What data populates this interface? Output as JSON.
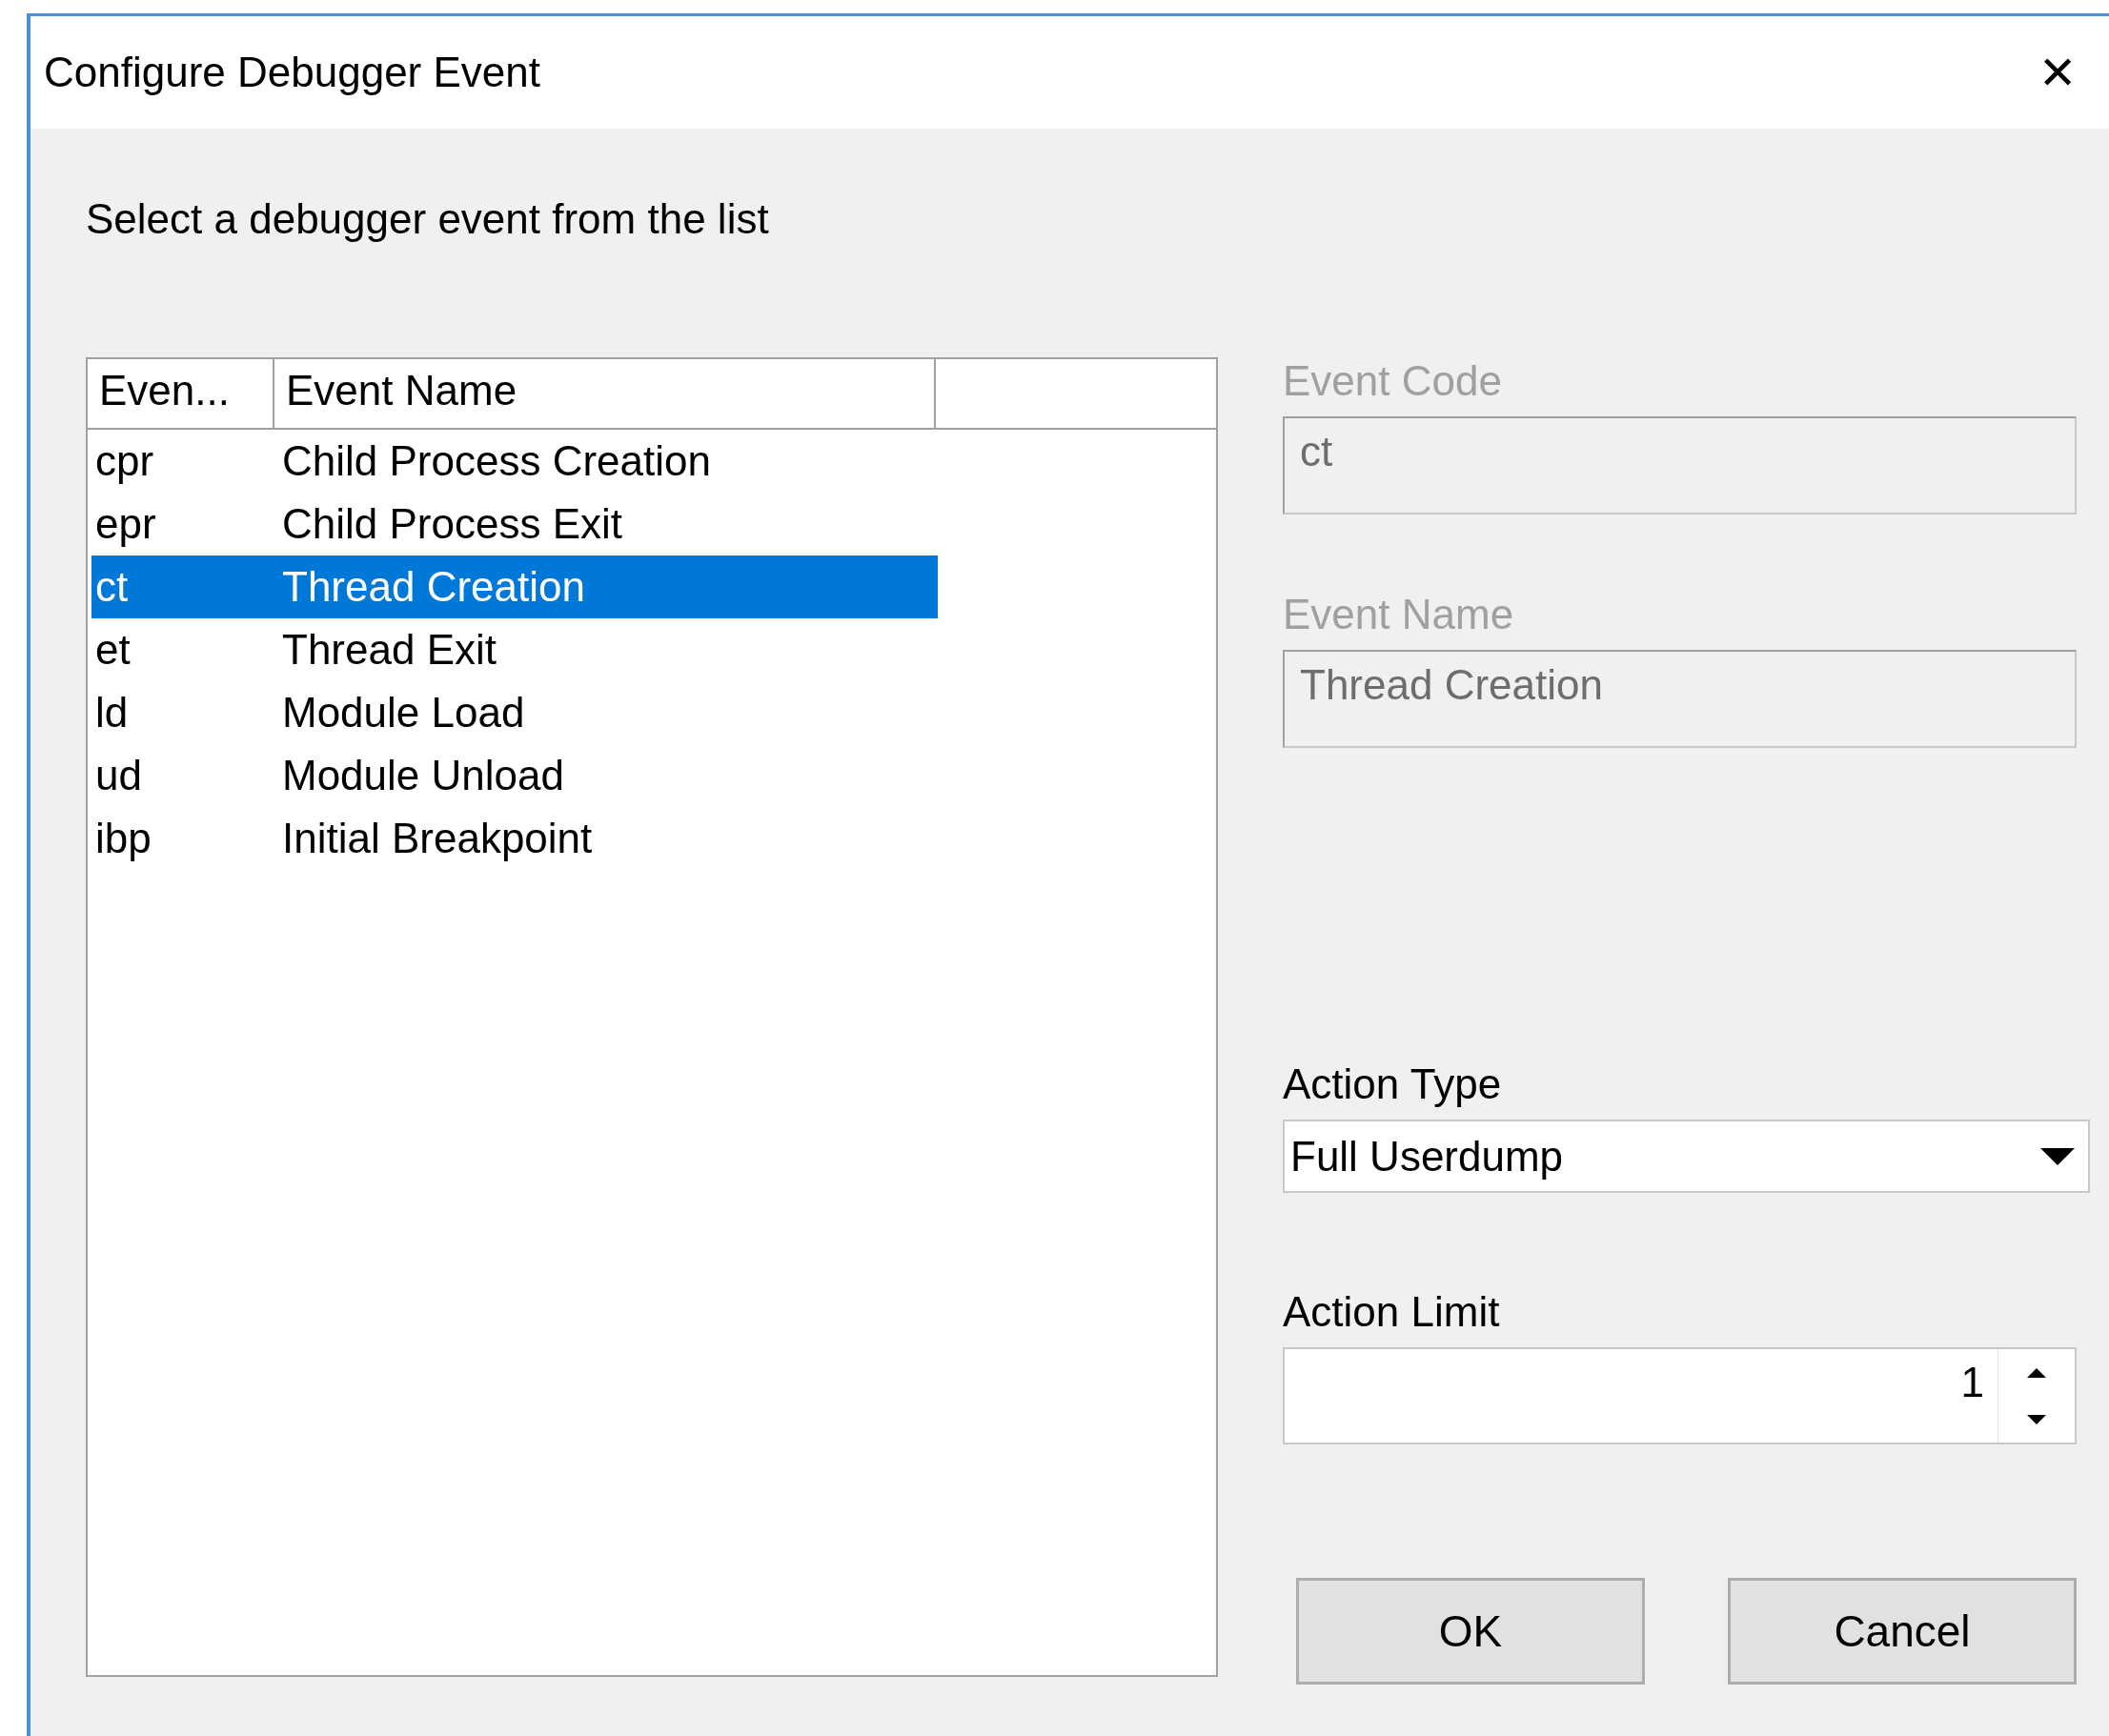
{
  "window": {
    "title": "Configure Debugger Event",
    "close": "✕"
  },
  "instruction": "Select a debugger event from the list",
  "list": {
    "columns": [
      "Even...",
      "Event Name"
    ],
    "rows": [
      {
        "code": "cpr",
        "name": "Child Process Creation",
        "selected": false
      },
      {
        "code": "epr",
        "name": "Child Process Exit",
        "selected": false
      },
      {
        "code": "ct",
        "name": "Thread Creation",
        "selected": true
      },
      {
        "code": "et",
        "name": "Thread Exit",
        "selected": false
      },
      {
        "code": "ld",
        "name": "Module Load",
        "selected": false
      },
      {
        "code": "ud",
        "name": "Module Unload",
        "selected": false
      },
      {
        "code": "ibp",
        "name": "Initial Breakpoint",
        "selected": false
      }
    ]
  },
  "fields": [
    {
      "kind": "text",
      "label": "Event Code",
      "value": "ct",
      "disabled": true
    },
    {
      "kind": "text",
      "label": "Event Name",
      "value": "Thread Creation",
      "disabled": true
    },
    {
      "kind": "combo",
      "label": "Action Type",
      "value": "Full Userdump",
      "disabled": false
    },
    {
      "kind": "spin",
      "label": "Action Limit",
      "value": "1",
      "disabled": false
    }
  ],
  "buttons": [
    "OK",
    "Cancel"
  ]
}
